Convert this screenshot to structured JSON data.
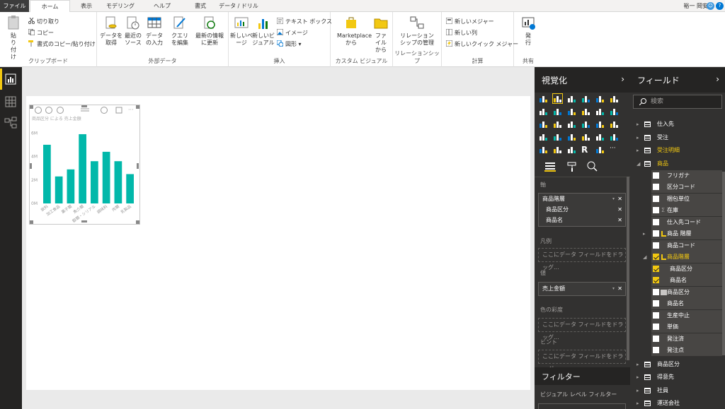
{
  "tabs": [
    {
      "label": "ファイル"
    },
    {
      "label": "ホーム"
    },
    {
      "label": "表示"
    },
    {
      "label": "モデリング"
    },
    {
      "label": "ヘルプ"
    },
    {
      "label": "書式"
    },
    {
      "label": "データ / ドリル"
    }
  ],
  "user": "裕一 岡安",
  "ribbon": {
    "clipboard": {
      "paste": "貼り付け",
      "cut": "切り取り",
      "copy": "コピー",
      "format_painter": "書式のコピー/貼り付け",
      "label": "クリップボード"
    },
    "external": {
      "get_data": "データを取得",
      "recent": "最近のソース",
      "enter_data": "データの入力",
      "label": "外部データ"
    },
    "edit_queries": "クエリを編集",
    "refresh": "最新の情報に更新",
    "insert": {
      "new_page": "新しいページ",
      "new_visual": "新しいビジュアル",
      "textbox": "テキスト ボックス",
      "image": "イメージ",
      "shapes": "図形",
      "label": "挿入"
    },
    "custom": {
      "marketplace": "Marketplaceから",
      "file": "ファイルから",
      "label": "カスタム ビジュアル"
    },
    "relations": {
      "manage": "リレーションシップの管理",
      "label": "リレーションシップ"
    },
    "calc": {
      "new_measure": "新しいメジャー",
      "new_column": "新しい列",
      "new_quick": "新しいクイック メジャー",
      "label": "計算"
    },
    "share": {
      "publish": "発行",
      "label": "共有"
    }
  },
  "chart_data": {
    "type": "bar",
    "title": "商品区分 による 売上金額",
    "categories": [
      "飲料",
      "加工食品",
      "菓子類",
      "魚介類",
      "穀類・シリアル",
      "調味料",
      "肉類",
      "乳製品"
    ],
    "values": [
      5.0,
      2.3,
      2.9,
      5.9,
      3.6,
      4.4,
      3.6,
      2.5
    ],
    "yticks": [
      "6M",
      "4M",
      "2M",
      "0M"
    ],
    "ylim": [
      0,
      6.5
    ],
    "color": "#01b8aa"
  },
  "viz": {
    "title": "視覚化",
    "axis_label": "軸",
    "axis_items": [
      "商品階層",
      "商品区分",
      "商品名"
    ],
    "legend_label": "凡例",
    "legend_placeholder": "ここにデータ フィールドをドラッグ...",
    "value_label": "値",
    "value_item": "売上金額",
    "saturation_label": "色の彩度",
    "saturation_placeholder": "ここにデータ フィールドをドラッグ...",
    "tooltip_label": "ヒント",
    "tooltip_placeholder": "ここにデータ フィールドをドラッグ...",
    "filter_title": "フィルター",
    "visual_filter": "ビジュアル レベル フィルター"
  },
  "fields": {
    "title": "フィールド",
    "search_placeholder": "検索",
    "tables": [
      "仕入先",
      "受注",
      "受注明細",
      "商品"
    ],
    "product_fields": [
      "フリガナ",
      "区分コード",
      "梱包単位",
      "在庫",
      "仕入先コード",
      "商品 階層",
      "商品コード",
      "商品階層"
    ],
    "hierarchy_children": [
      "商品区分",
      "商品名"
    ],
    "product_fields2": [
      "商品区分",
      "商品名",
      "生産中止",
      "単価",
      "発注済",
      "発注点"
    ],
    "tables2": [
      "商品区分",
      "得意先",
      "社員",
      "運送会社"
    ]
  },
  "colors": {
    "accent": "#f2c811",
    "bar": "#01b8aa",
    "pane": "#323130"
  }
}
